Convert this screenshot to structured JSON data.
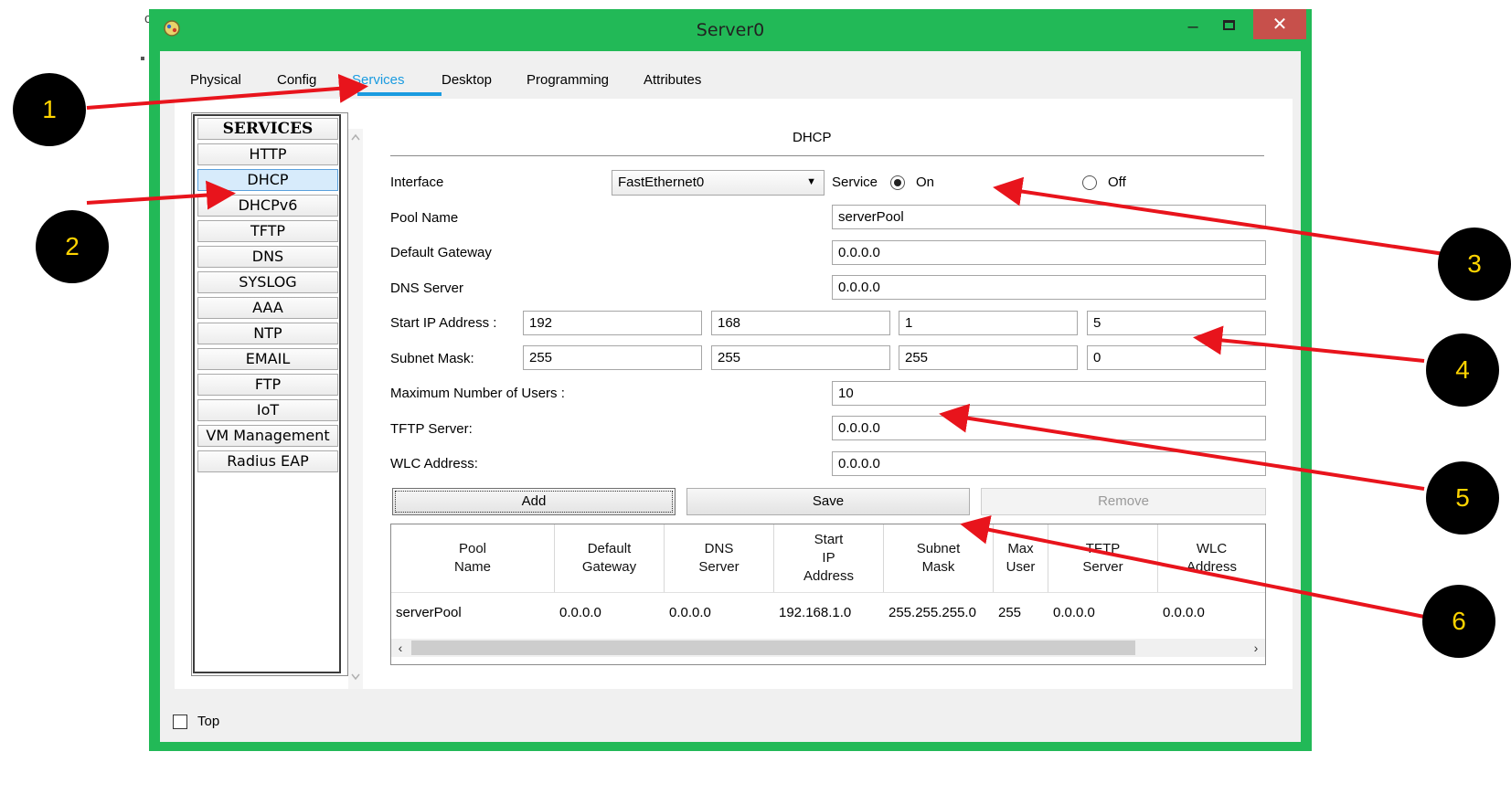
{
  "window": {
    "title": "Server0",
    "minimize_label": "–",
    "close_label": "✕",
    "accent": "#22b957",
    "close_color": "#c7504b"
  },
  "tabs": [
    {
      "label": "Physical",
      "active": false
    },
    {
      "label": "Config",
      "active": false
    },
    {
      "label": "Services",
      "active": true
    },
    {
      "label": "Desktop",
      "active": false
    },
    {
      "label": "Programming",
      "active": false
    },
    {
      "label": "Attributes",
      "active": false
    }
  ],
  "services": {
    "header": "SERVICES",
    "items": [
      "HTTP",
      "DHCP",
      "DHCPv6",
      "TFTP",
      "DNS",
      "SYSLOG",
      "AAA",
      "NTP",
      "EMAIL",
      "FTP",
      "IoT",
      "VM Management",
      "Radius EAP"
    ],
    "selected": "DHCP"
  },
  "dhcp": {
    "title": "DHCP",
    "interface_label": "Interface",
    "interface_value": "FastEthernet0",
    "service_label": "Service",
    "on_label": "On",
    "off_label": "Off",
    "service_on": true,
    "pool_name_label": "Pool Name",
    "pool_name": "serverPool",
    "default_gateway_label": "Default Gateway",
    "default_gateway": "0.0.0.0",
    "dns_server_label": "DNS Server",
    "dns_server": "0.0.0.0",
    "start_ip_label": "Start IP Address :",
    "start_ip": [
      "192",
      "168",
      "1",
      "5"
    ],
    "subnet_mask_label": "Subnet Mask:",
    "subnet_mask": [
      "255",
      "255",
      "255",
      "0"
    ],
    "max_users_label": "Maximum Number of Users :",
    "max_users": "10",
    "tftp_server_label": "TFTP Server:",
    "tftp_server": "0.0.0.0",
    "wlc_address_label": "WLC Address:",
    "wlc_address": "0.0.0.0",
    "add_label": "Add",
    "save_label": "Save",
    "remove_label": "Remove"
  },
  "pool_table": {
    "columns": [
      "Pool\nName",
      "Default\nGateway",
      "DNS\nServer",
      "Start\nIP\nAddress",
      "Subnet\nMask",
      "Max\nUser",
      "TFTP\nServer",
      "WLC\nAddress"
    ],
    "rows": [
      [
        "serverPool",
        "0.0.0.0",
        "0.0.0.0",
        "192.168.1.0",
        "255.255.255.0",
        "255",
        "0.0.0.0",
        "0.0.0.0"
      ]
    ]
  },
  "footer": {
    "top_label": "Top",
    "top_checked": false
  },
  "callouts": [
    "1",
    "2",
    "3",
    "4",
    "5",
    "6"
  ],
  "callout_text_color": "#ffd400",
  "arrow_color": "#e8141c"
}
